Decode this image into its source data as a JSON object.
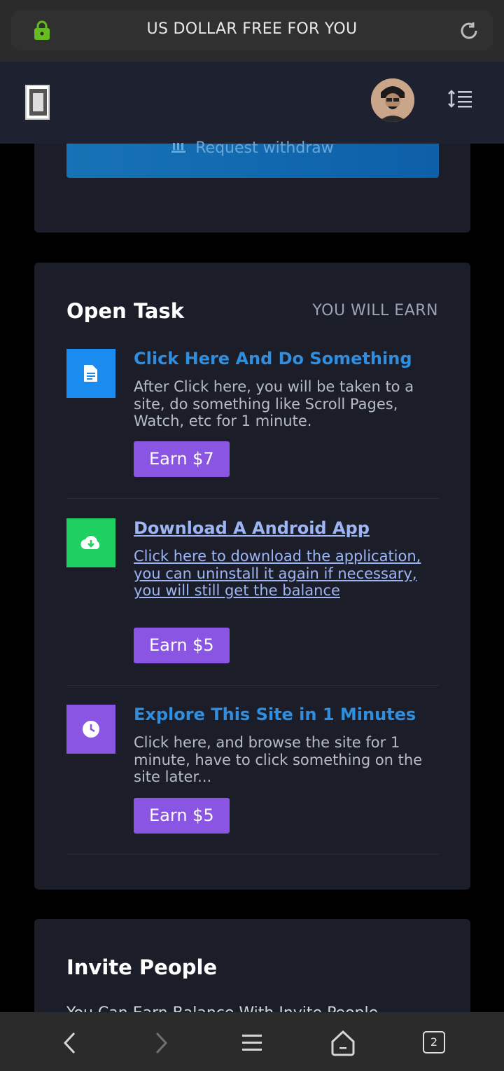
{
  "browser": {
    "title": "US DOLLAR FREE FOR YOU",
    "tab_count": "2",
    "icons": {
      "lock": "lock-icon",
      "reload": "reload-icon",
      "back": "back-icon",
      "forward": "forward-icon",
      "menu": "menu-icon",
      "home": "home-icon"
    },
    "colors": {
      "lock": "#66bb22"
    }
  },
  "header": {
    "logo": "site-logo",
    "avatar": "user-avatar",
    "menu_icon": "menu-lines-icon"
  },
  "withdraw": {
    "label": "Request withdraw"
  },
  "open_task": {
    "title": "Open Task",
    "earn_header": "YOU WILL EARN",
    "tasks": [
      {
        "title": "Click Here And Do Something",
        "desc": "After Click here, you will be taken to a site, do something like Scroll Pages, Watch, etc for 1 minute.",
        "button": "Earn $7",
        "icon": "document-icon",
        "color": "#1a8cf0"
      },
      {
        "title": "Download A Android App",
        "desc": "Click here to download the application, you can uninstall it again if necessary, you will still get the balance",
        "button": "Earn $5",
        "icon": "cloud-download-icon",
        "color": "#1ed05f"
      },
      {
        "title": "Explore This Site in 1 Minutes",
        "desc": "Click here, and browse the site for 1 minute, have to click something on the site later...",
        "button": "Earn $5",
        "icon": "clock-icon",
        "color": "#8b55e4"
      }
    ]
  },
  "invite": {
    "title": "Invite People",
    "text": "You Can Earn Balance With Invite People"
  }
}
